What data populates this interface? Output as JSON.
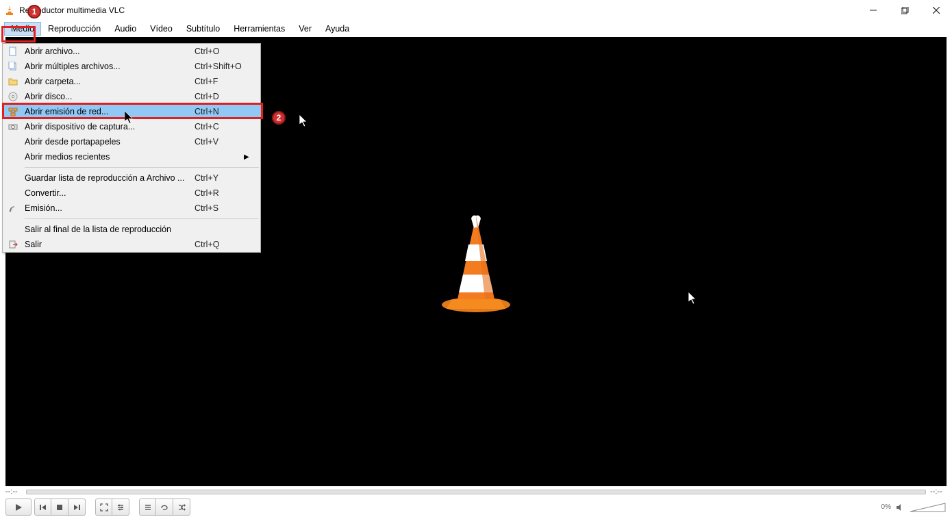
{
  "titlebar": {
    "title": "Reproductor multimedia VLC"
  },
  "window_buttons": {
    "minimize": "–",
    "maximize": "❐",
    "close": "✕"
  },
  "menubar": [
    "Medio",
    "Reproducción",
    "Audio",
    "Vídeo",
    "Subtítulo",
    "Herramientas",
    "Ver",
    "Ayuda"
  ],
  "menubar_active_index": 0,
  "dropdown": {
    "groups": [
      [
        {
          "icon": "file-icon",
          "label": "Abrir archivo...",
          "shortcut": "Ctrl+O"
        },
        {
          "icon": "files-icon",
          "label": "Abrir múltiples archivos...",
          "shortcut": "Ctrl+Shift+O"
        },
        {
          "icon": "folder-icon",
          "label": "Abrir carpeta...",
          "shortcut": "Ctrl+F"
        },
        {
          "icon": "disc-icon",
          "label": "Abrir disco...",
          "shortcut": "Ctrl+D"
        },
        {
          "icon": "network-icon",
          "label": "Abrir emisión de red...",
          "shortcut": "Ctrl+N",
          "highlighted": true
        },
        {
          "icon": "capture-icon",
          "label": "Abrir dispositivo de captura...",
          "shortcut": "Ctrl+C"
        },
        {
          "icon": "",
          "label": "Abrir desde portapapeles",
          "shortcut": "Ctrl+V"
        },
        {
          "icon": "",
          "label": "Abrir medios recientes",
          "shortcut": "",
          "submenu": true
        }
      ],
      [
        {
          "icon": "",
          "label": "Guardar lista de reproducción a Archivo ...",
          "shortcut": "Ctrl+Y"
        },
        {
          "icon": "",
          "label": "Convertir...",
          "shortcut": "Ctrl+R"
        },
        {
          "icon": "stream-icon",
          "label": "Emisión...",
          "shortcut": "Ctrl+S"
        }
      ],
      [
        {
          "icon": "",
          "label": "Salir al final de la lista de reproducción",
          "shortcut": ""
        },
        {
          "icon": "quit-icon",
          "label": "Salir",
          "shortcut": "Ctrl+Q"
        }
      ]
    ]
  },
  "markers": {
    "one": "1",
    "two": "2"
  },
  "seek": {
    "left_time": "--:--",
    "right_time": "--:--"
  },
  "volume": {
    "percent": "0%"
  },
  "control_icons": {
    "play": "▶",
    "prev": "⏮",
    "stop": "■",
    "next": "⏭",
    "fullscreen": "⛶",
    "extended": "☰",
    "playlist": "≡",
    "loop": "↻",
    "shuffle": "⤭"
  }
}
